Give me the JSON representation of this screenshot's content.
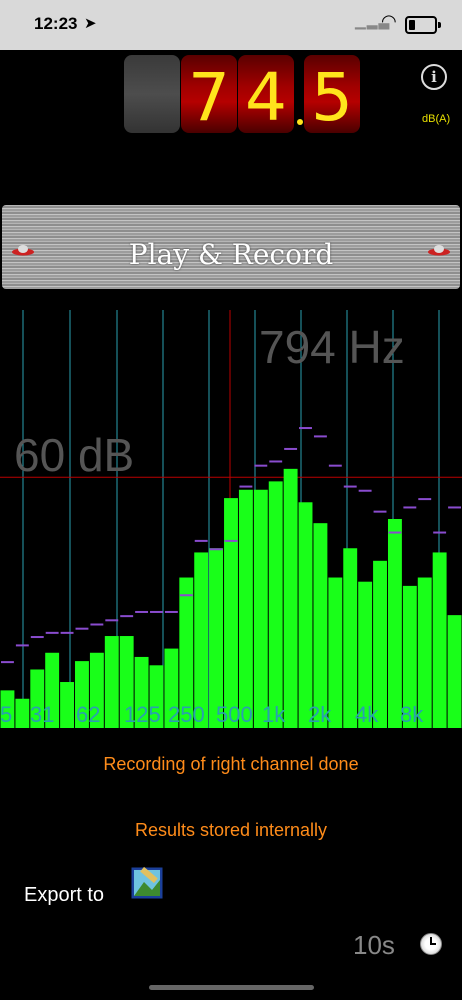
{
  "status": {
    "time": "12:23",
    "location_icon": "location-arrow-icon",
    "signal_icon": "cellular-signal-icon",
    "wifi_icon": "wifi-icon",
    "battery_icon": "battery-icon",
    "battery_level": 0.2
  },
  "meter": {
    "digits": [
      "",
      "7",
      "4",
      "5"
    ],
    "unit": "dB(A)"
  },
  "info_icon": "info-icon",
  "play": {
    "label": "Play & Record",
    "icon": "ufo-icon"
  },
  "spectrum": {
    "frequency_readout": "794 Hz",
    "level_readout": "60 dB",
    "band_labels": [
      "5",
      "31",
      "62",
      "125",
      "250",
      "500",
      "1k",
      "2k",
      "4k",
      "8k"
    ]
  },
  "messages": {
    "recording": "Recording of right channel done",
    "stored": "Results stored internally"
  },
  "export": {
    "label": "Export to",
    "icon": "photo-library-icon"
  },
  "timer": {
    "label": "10s",
    "icon": "clock-icon"
  },
  "chart_data": {
    "type": "bar",
    "ylabel": "",
    "series": [
      {
        "name": "",
        "values": [
          9,
          7,
          14,
          18,
          11,
          16,
          18,
          22,
          22,
          17,
          15,
          19,
          36,
          42,
          43,
          55,
          57,
          57,
          59,
          62,
          54,
          49,
          36,
          43,
          35,
          40,
          50,
          34,
          36,
          42,
          27
        ]
      },
      {
        "name": "",
        "values": [
          16,
          20,
          22,
          23,
          23,
          24,
          25,
          26,
          27,
          28,
          28,
          28,
          32,
          45,
          43,
          45,
          58,
          63,
          64,
          67,
          72,
          70,
          63,
          58,
          57,
          52,
          47,
          53,
          55,
          47,
          53
        ]
      }
    ]
  }
}
